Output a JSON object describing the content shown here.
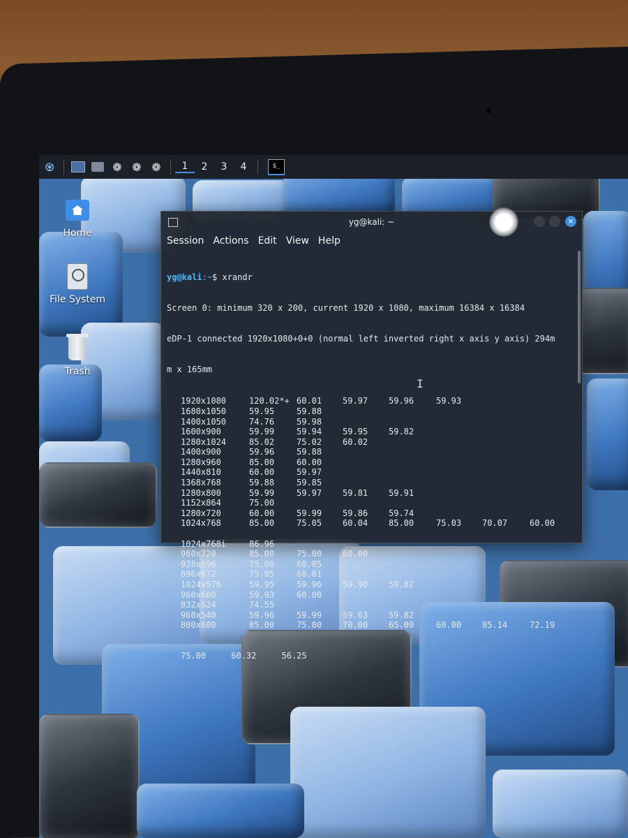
{
  "panel": {
    "workspaces": [
      "1",
      "2",
      "3",
      "4"
    ],
    "task_label": "$_"
  },
  "desktop_icons": [
    {
      "label": "Home"
    },
    {
      "label": "File System"
    },
    {
      "label": "Trash"
    }
  ],
  "terminal": {
    "title": "yg@kali: ~",
    "close_glyph": "×",
    "menu": [
      "Session",
      "Actions",
      "Edit",
      "View",
      "Help"
    ],
    "prompt_user": "yg@kali",
    "prompt_path": ":~",
    "prompt_symbol": "$ ",
    "command": "xrandr",
    "lines": [
      "Screen 0: minimum 320 x 200, current 1920 x 1080, maximum 16384 x 16384",
      "eDP-1 connected 1920x1080+0+0 (normal left inverted right x axis y axis) 294m",
      "m x 165mm"
    ],
    "modes": [
      [
        "1920x1080",
        "120.02*+",
        "60.01",
        "59.97",
        "59.96",
        "59.93"
      ],
      [
        "1680x1050",
        "59.95",
        "59.88"
      ],
      [
        "1400x1050",
        "74.76",
        "59.98"
      ],
      [
        "1600x900",
        "59.99",
        "59.94",
        "59.95",
        "59.82"
      ],
      [
        "1280x1024",
        "85.02",
        "75.02",
        "60.02"
      ],
      [
        "1400x900",
        "59.96",
        "59.88"
      ],
      [
        "1280x960",
        "85.00",
        "60.00"
      ],
      [
        "1440x810",
        "60.00",
        "59.97"
      ],
      [
        "1368x768",
        "59.88",
        "59.85"
      ],
      [
        "1280x800",
        "59.99",
        "59.97",
        "59.81",
        "59.91"
      ],
      [
        "1152x864",
        "75.00"
      ],
      [
        "1280x720",
        "60.00",
        "59.99",
        "59.86",
        "59.74"
      ],
      [
        "1024x768",
        "85.00",
        "75.05",
        "60.04",
        "85.00",
        "75.03",
        "70.07",
        "60.00"
      ],
      [],
      [
        "1024x768i",
        "86.96"
      ],
      [
        "960x720",
        "85.00",
        "75.00",
        "60.00"
      ],
      [
        "928x696",
        "75.00",
        "60.05"
      ],
      [
        "896x672",
        "75.05",
        "60.01"
      ],
      [
        "1024x576",
        "59.95",
        "59.96",
        "59.90",
        "59.82"
      ],
      [
        "960x600",
        "59.93",
        "60.00"
      ],
      [
        "832x624",
        "74.55"
      ],
      [
        "960x540",
        "59.96",
        "59.99",
        "59.63",
        "59.82"
      ],
      [
        "800x600",
        "85.00",
        "75.00",
        "70.00",
        "65.00",
        "60.00",
        "85.14",
        "72.19"
      ]
    ],
    "last_line": "75.00     60.32     56.25"
  }
}
